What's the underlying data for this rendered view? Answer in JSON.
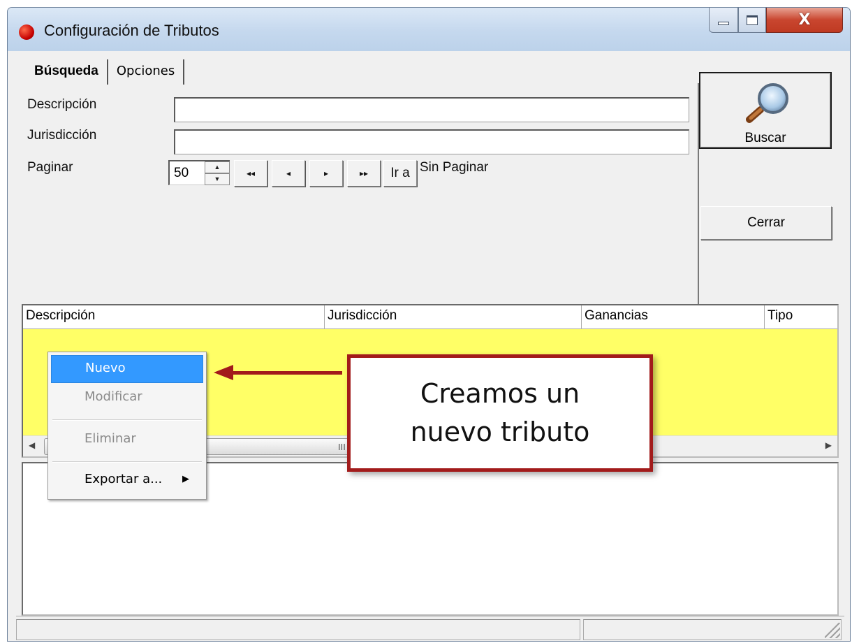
{
  "window": {
    "title": "Configuración de Tributos",
    "close_glyph": "X"
  },
  "tabs": [
    {
      "label": "Búsqueda",
      "active": true
    },
    {
      "label": "Opciones",
      "active": false
    }
  ],
  "search": {
    "descripcion_label": "Descripción",
    "descripcion_value": "",
    "jurisdiccion_label": "Jurisdicción",
    "jurisdiccion_value": "",
    "paginar_label": "Paginar",
    "paginar_value": "50",
    "nav_first": "◂◂",
    "nav_prev": "◂",
    "nav_next": "▸",
    "nav_last": "▸▸",
    "ir_a_label": "Ir a",
    "paging_status": "Sin Paginar"
  },
  "buttons": {
    "buscar_label": "Buscar",
    "cerrar_label": "Cerrar"
  },
  "grid": {
    "columns": [
      "Descripción",
      "Jurisdicción",
      "Ganancias",
      "Tipo"
    ],
    "scroll_grip": "III"
  },
  "context_menu": {
    "items": [
      {
        "label": "Nuevo",
        "state": "highlighted"
      },
      {
        "label": "Modificar",
        "state": "disabled"
      },
      {
        "label": "Eliminar",
        "state": "disabled"
      },
      {
        "label": "Exportar a...",
        "state": "enabled",
        "has_submenu": true
      }
    ]
  },
  "callout": {
    "line1": "Creamos un",
    "line2": "nuevo tributo"
  },
  "colors": {
    "highlight": "#3399ff",
    "row_highlight": "#ffff66",
    "callout_border": "#a21b1b"
  },
  "icons": [
    "app-icon",
    "magnifier-icon",
    "submenu-arrow-icon",
    "resize-grip-icon"
  ]
}
